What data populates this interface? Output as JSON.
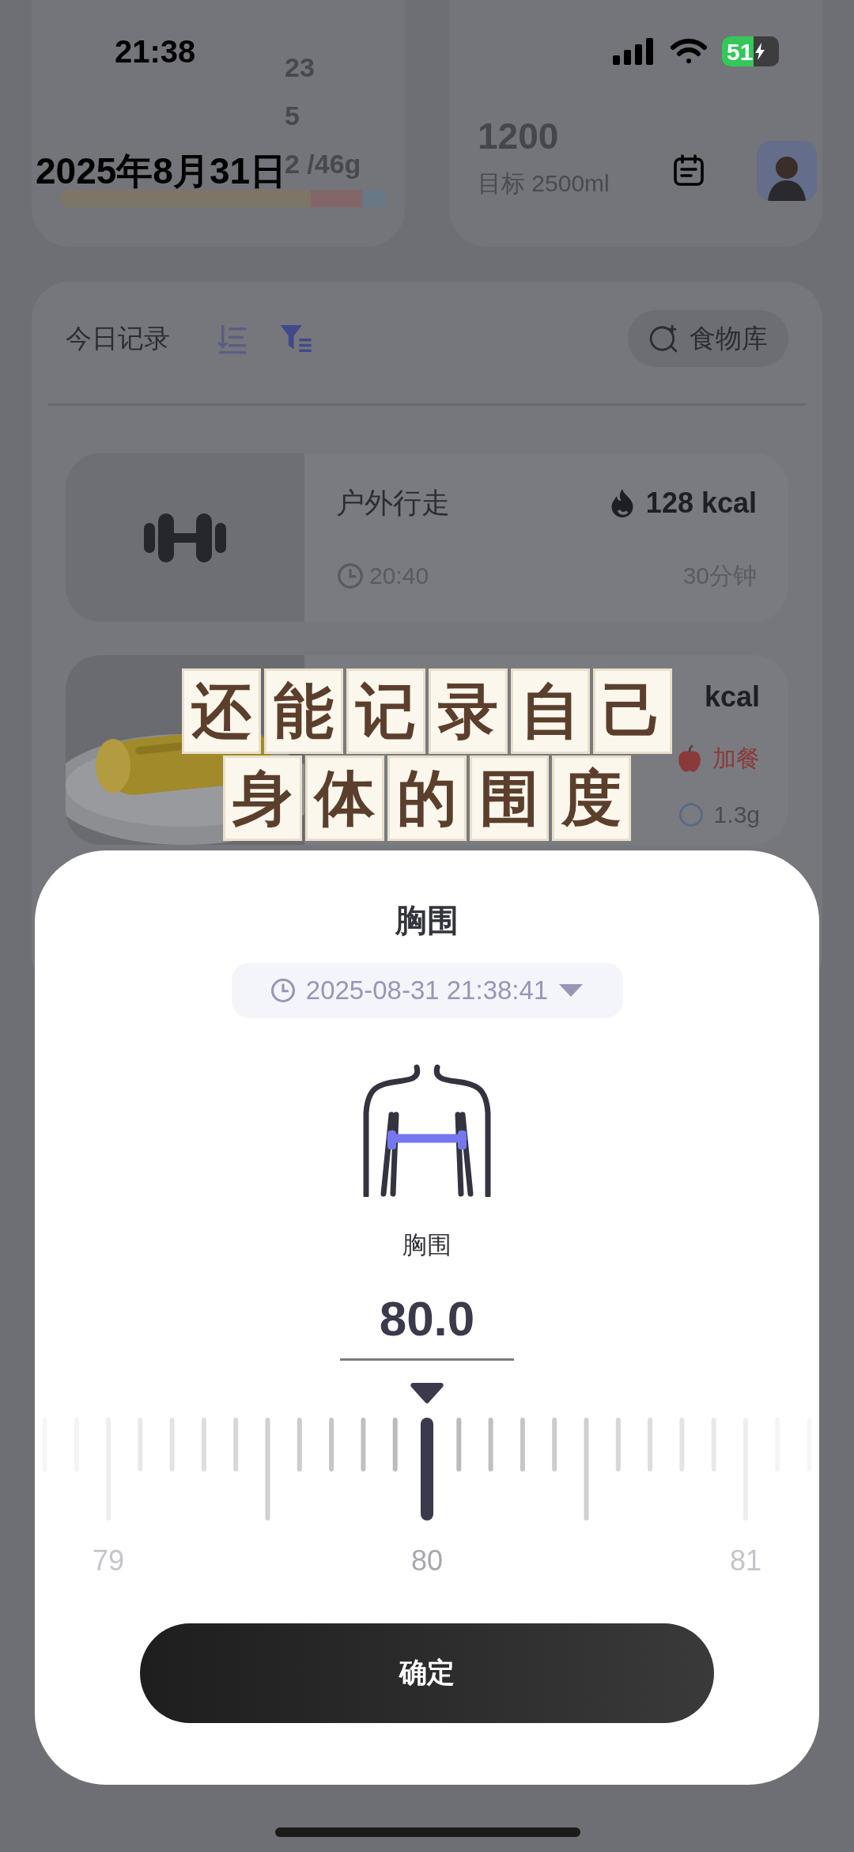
{
  "status_bar": {
    "time": "21:38",
    "battery": "51"
  },
  "header": {
    "date": "2025年8月31日"
  },
  "nutrition_card": {
    "lines": [
      "23",
      "5",
      "2 /46g"
    ],
    "bar_segments": [
      {
        "color": "#7d7568"
      },
      {
        "color": "#826668"
      },
      {
        "color": "#687884"
      }
    ]
  },
  "water_card": {
    "amount": "1200",
    "target": "目标 2500ml"
  },
  "records": {
    "title": "今日记录",
    "food_library_button": "食物库",
    "items": [
      {
        "kind": "exercise",
        "name": "户外行走",
        "calories": "128 kcal",
        "time": "20:40",
        "duration": "30分钟"
      },
      {
        "kind": "food",
        "calories": "kcal",
        "meal": "加餐",
        "nutrients": [
          "1.3g"
        ]
      }
    ]
  },
  "caption": {
    "lines": [
      "还能记录自己",
      "身体的围度"
    ]
  },
  "sheet": {
    "title": "胸围",
    "datetime": "2025-08-31 21:38:41",
    "measure_label": "胸围",
    "value": "80.0",
    "scale_labels": [
      "79",
      "80",
      "81"
    ],
    "confirm": "确定"
  }
}
